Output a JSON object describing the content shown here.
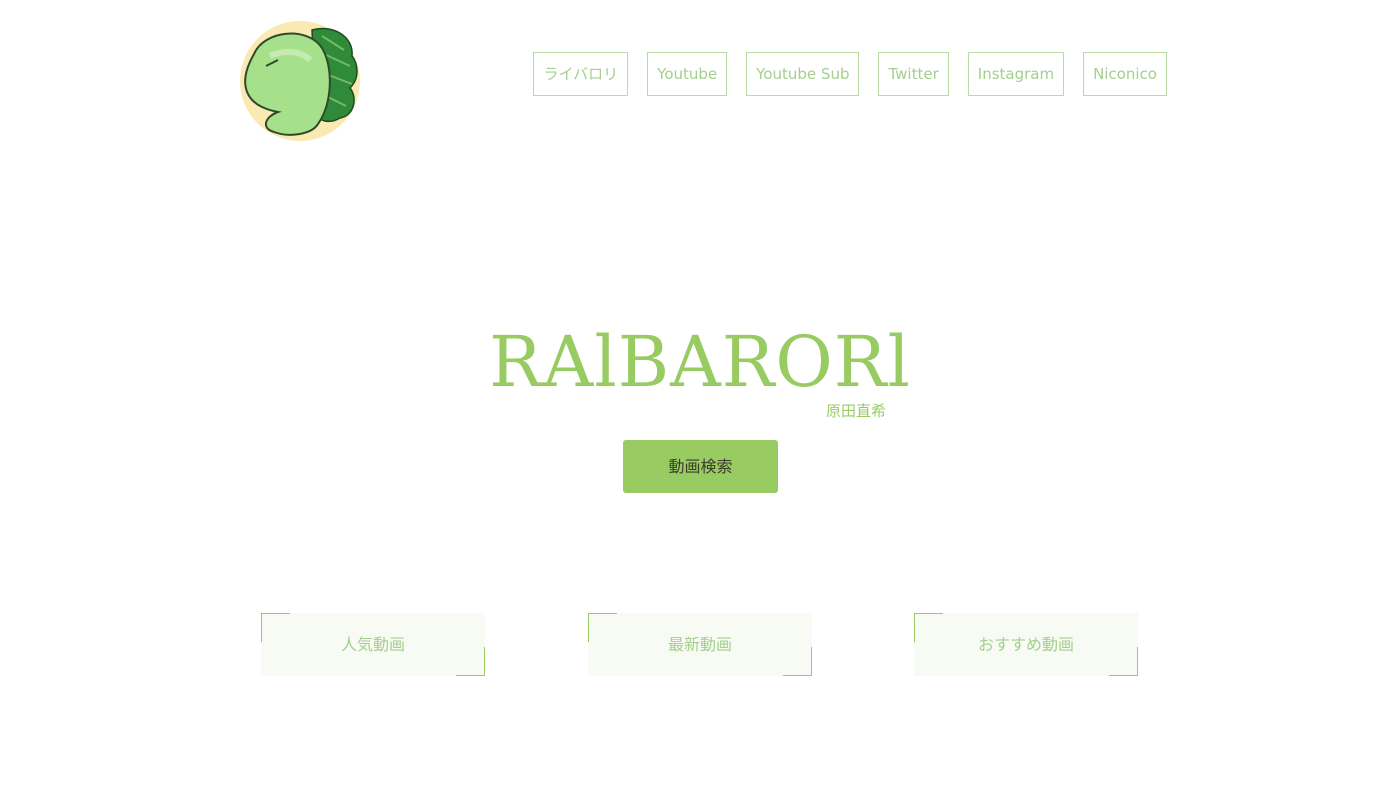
{
  "logo": {
    "icon": "green-dinosaur-mascot-icon",
    "colors": {
      "circle": "#fbe9b3",
      "body": "#a6e08a",
      "spikes": "#2f8a3a",
      "outline": "#2f4a2a"
    }
  },
  "nav": {
    "items": [
      {
        "label": "ライバロリ"
      },
      {
        "label": "Youtube"
      },
      {
        "label": "Youtube Sub"
      },
      {
        "label": "Twitter"
      },
      {
        "label": "Instagram"
      },
      {
        "label": "Niconico"
      }
    ]
  },
  "hero": {
    "title": "RAlBARORl",
    "subtitle": "原田直希",
    "search_button": "動画検索"
  },
  "categories": [
    {
      "label": "人気動画"
    },
    {
      "label": "最新動画"
    },
    {
      "label": "おすすめ動画"
    }
  ],
  "theme": {
    "accent": "#98cc63",
    "accent_light": "#a4cf8e",
    "border": "#b9dca6",
    "card_bg": "#f7fbf3"
  }
}
